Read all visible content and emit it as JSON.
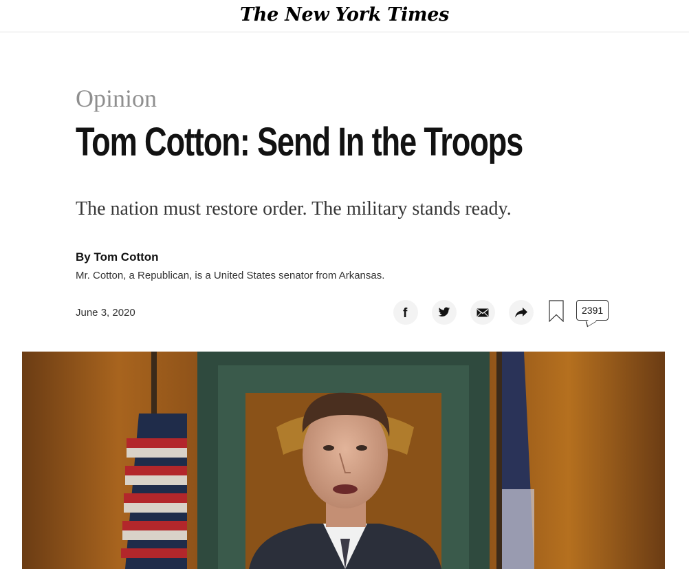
{
  "masthead": {
    "logo": "The New York Times"
  },
  "article": {
    "kicker": "Opinion",
    "headline": "Tom Cotton: Send In the Troops",
    "dek": "The nation must restore order. The military stands ready.",
    "byline": "By Tom Cotton",
    "bio": "Mr. Cotton, a Republican, is a United States senator from Arkansas.",
    "date": "June 3, 2020"
  },
  "share": {
    "icons": [
      "facebook-icon",
      "twitter-icon",
      "email-icon",
      "share-icon",
      "bookmark-icon",
      "comment-icon"
    ],
    "comment_count": "2391"
  },
  "colors": {
    "kicker": "#8f8f8f",
    "text": "#121212",
    "button_bg": "#f3f3f3",
    "divider": "#e2e2e2"
  }
}
